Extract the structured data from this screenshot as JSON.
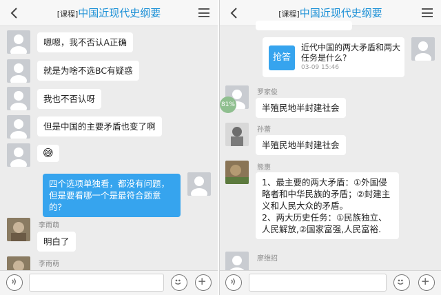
{
  "header": {
    "tag": "[课程]",
    "title": "中国近现代史纲要"
  },
  "left": {
    "messages": [
      "嗯嗯，我不否认A正确",
      "就是为啥不选BC有疑惑",
      "我也不否认呀",
      "但是中国的主要矛盾也变了啊",
      "四个选项单独看，都没有问题，但是要看哪一个是最符合题意的？",
      "明白了"
    ],
    "sender_1": "李雨萌",
    "sender_2": "李雨萌",
    "emoji": "😅"
  },
  "right": {
    "card": {
      "button": "抢答",
      "question": "近代中国的两大矛盾和两大任务是什么?",
      "time": "03-09 15:46"
    },
    "badge": "81%",
    "messages": [
      {
        "sender": "罗家俊",
        "text": "半殖民地半封建社会"
      },
      {
        "sender": "孙蕾",
        "text": "半殖民地半封建社会"
      },
      {
        "sender": "熊惠",
        "text": "1、最主要的两大矛盾：①外国侵略者和中华民族的矛盾；②封建主义和人民大众的矛盾。\n2、两大历史任务：①民族独立、人民解放,②国家富强,人民富裕."
      },
      {
        "sender": "廖维招"
      }
    ]
  },
  "icons": {
    "back": "back-arrow-icon",
    "menu": "menu-icon",
    "voice": "voice-icon",
    "emoji": "emoji-icon",
    "plus": "plus-icon",
    "avatar": "person-icon"
  },
  "colors": {
    "accent": "#36a4ee",
    "title": "#1a8fd6",
    "background": "#ececec"
  }
}
